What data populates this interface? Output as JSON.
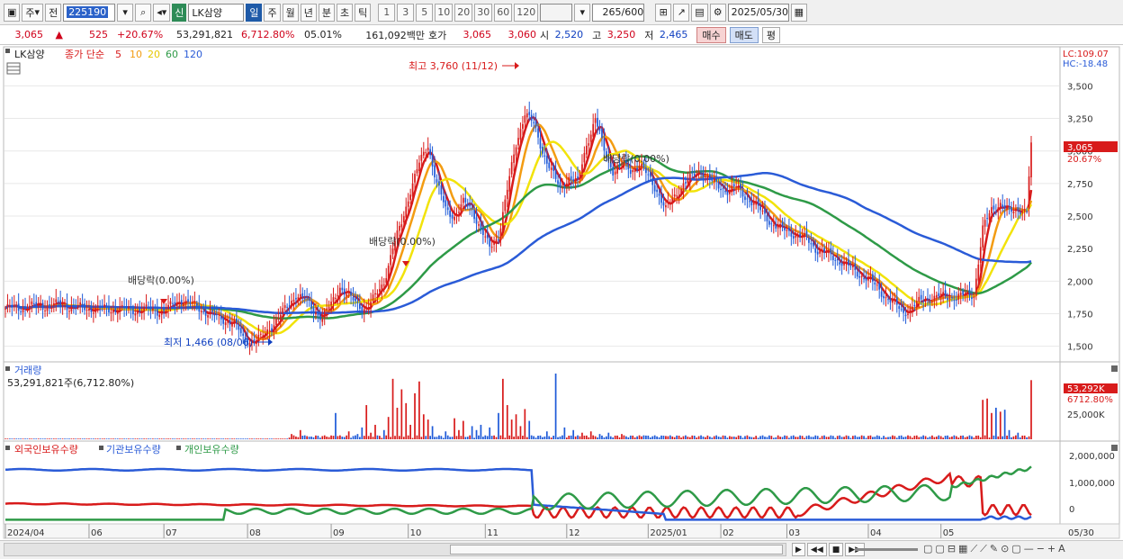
{
  "toolbar": {
    "period_type": "주",
    "prev_label": "전",
    "code": "225190",
    "badge": "신",
    "name": "LK삼양",
    "periods": [
      "일",
      "주",
      "월",
      "년",
      "분",
      "초",
      "틱"
    ],
    "active_period": "일",
    "intervals": [
      "1",
      "3",
      "5",
      "10",
      "20",
      "30",
      "60",
      "120"
    ],
    "count": "265",
    "count_max": "/600",
    "date": "2025/05/30"
  },
  "quote": {
    "price": "3,065",
    "change": "525",
    "change_pct": "+20.67%",
    "volume": "53,291,821",
    "volume_pct": "6,712.80%",
    "turnover_pct": "05.01%",
    "amount": "161,092백만",
    "bid_label": "호가",
    "ask": "3,065",
    "bid": "3,060",
    "open_label": "시",
    "open": "2,520",
    "high_label": "고",
    "high": "3,250",
    "low_label": "저",
    "low": "2,465",
    "buy_label": "매수",
    "sell_label": "매도",
    "pyeong_label": "평"
  },
  "chart_data": {
    "type": "candlestick",
    "legend": {
      "name": "LK삼양",
      "ma_label": "종가 단순",
      "ma_periods": [
        "5",
        "10",
        "20",
        "60",
        "120"
      ],
      "ma_colors": [
        "#d81b1b",
        "#f39c12",
        "#f2e30a",
        "#2e9a47",
        "#2a5bd7"
      ]
    },
    "price_axis": [
      "3,500",
      "3,250",
      "3,000",
      "2,750",
      "2,500",
      "2,250",
      "2,000",
      "1,750",
      "1,500"
    ],
    "price_range": [
      1380,
      3800
    ],
    "lc": "LC:109.07",
    "hc": "HC:-18.48",
    "last_price_tag": "3,065",
    "last_pct_tag": "20.67%",
    "annotations": {
      "high": "최고 3,760 (11/12)",
      "low": "최저 1,466 (08/06)",
      "div1": "배당락(0.00%)",
      "div2": "배당락(0.00%)",
      "div3": "배당락(0.00%)"
    },
    "x_labels": [
      "2024/04",
      "06",
      "07",
      "08",
      "09",
      "10",
      "11",
      "12",
      "2025/01",
      "02",
      "03",
      "04",
      "05"
    ],
    "x_right_label": "05/30",
    "close_points": [
      [
        0,
        1790
      ],
      [
        8,
        1800
      ],
      [
        16,
        1810
      ],
      [
        24,
        1820
      ],
      [
        32,
        1800
      ],
      [
        40,
        1790
      ],
      [
        48,
        1785
      ],
      [
        56,
        1780
      ],
      [
        64,
        1780
      ],
      [
        72,
        1770
      ],
      [
        80,
        1860
      ],
      [
        84,
        1820
      ],
      [
        88,
        1790
      ],
      [
        92,
        1760
      ],
      [
        96,
        1720
      ],
      [
        100,
        1700
      ],
      [
        104,
        1680
      ],
      [
        108,
        1560
      ],
      [
        112,
        1540
      ],
      [
        116,
        1560
      ],
      [
        120,
        1640
      ],
      [
        124,
        1720
      ],
      [
        128,
        1800
      ],
      [
        132,
        1900
      ],
      [
        136,
        1860
      ],
      [
        140,
        1780
      ],
      [
        144,
        1720
      ],
      [
        148,
        1820
      ],
      [
        152,
        1960
      ],
      [
        156,
        1880
      ],
      [
        160,
        1820
      ],
      [
        164,
        1790
      ],
      [
        168,
        1880
      ],
      [
        172,
        2000
      ],
      [
        176,
        2250
      ],
      [
        180,
        2450
      ],
      [
        184,
        2700
      ],
      [
        188,
        2900
      ],
      [
        192,
        3050
      ],
      [
        196,
        2750
      ],
      [
        200,
        2550
      ],
      [
        204,
        2500
      ],
      [
        208,
        2600
      ],
      [
        212,
        2550
      ],
      [
        216,
        2400
      ],
      [
        220,
        2250
      ],
      [
        224,
        2350
      ],
      [
        228,
        2700
      ],
      [
        232,
        3050
      ],
      [
        236,
        3300
      ],
      [
        240,
        3200
      ],
      [
        244,
        3000
      ],
      [
        248,
        2850
      ],
      [
        252,
        2700
      ],
      [
        256,
        2800
      ],
      [
        260,
        2750
      ],
      [
        264,
        3050
      ],
      [
        268,
        3250
      ],
      [
        272,
        3000
      ],
      [
        276,
        2850
      ],
      [
        280,
        2900
      ],
      [
        284,
        2850
      ],
      [
        288,
        2900
      ],
      [
        292,
        2800
      ],
      [
        296,
        2700
      ],
      [
        300,
        2550
      ],
      [
        304,
        2650
      ],
      [
        308,
        2750
      ],
      [
        312,
        2800
      ],
      [
        316,
        2850
      ],
      [
        320,
        2780
      ],
      [
        324,
        2720
      ],
      [
        328,
        2700
      ],
      [
        332,
        2720
      ],
      [
        336,
        2650
      ],
      [
        340,
        2600
      ],
      [
        344,
        2520
      ],
      [
        348,
        2450
      ],
      [
        352,
        2400
      ],
      [
        356,
        2380
      ],
      [
        360,
        2350
      ],
      [
        364,
        2320
      ],
      [
        368,
        2250
      ],
      [
        372,
        2220
      ],
      [
        376,
        2180
      ],
      [
        380,
        2150
      ],
      [
        384,
        2100
      ],
      [
        388,
        2050
      ],
      [
        392,
        2020
      ],
      [
        396,
        1950
      ],
      [
        400,
        1880
      ],
      [
        404,
        1820
      ],
      [
        408,
        1760
      ],
      [
        412,
        1800
      ],
      [
        416,
        1850
      ],
      [
        420,
        1870
      ],
      [
        424,
        1880
      ],
      [
        428,
        1880
      ],
      [
        432,
        1880
      ],
      [
        436,
        1890
      ],
      [
        440,
        1900
      ],
      [
        444,
        2400
      ],
      [
        448,
        2550
      ],
      [
        452,
        2600
      ],
      [
        456,
        2520
      ],
      [
        460,
        2560
      ],
      [
        464,
        2540
      ],
      [
        466,
        3065
      ]
    ],
    "volume_label": "거래량",
    "volume_value": "53,291,821주(6,712.80%)",
    "volume_axis": [
      "25,000K"
    ],
    "volume_tag_1": "53,292K",
    "volume_tag_2": "6712.80%",
    "volume_bars": [
      [
        130,
        8
      ],
      [
        134,
        14
      ],
      [
        136,
        6
      ],
      [
        138,
        4
      ],
      [
        140,
        3
      ],
      [
        150,
        40
      ],
      [
        156,
        12
      ],
      [
        160,
        8
      ],
      [
        162,
        18
      ],
      [
        164,
        52
      ],
      [
        166,
        10
      ],
      [
        168,
        22
      ],
      [
        172,
        14
      ],
      [
        174,
        34
      ],
      [
        176,
        92
      ],
      [
        178,
        48
      ],
      [
        180,
        76
      ],
      [
        182,
        55
      ],
      [
        184,
        22
      ],
      [
        186,
        70
      ],
      [
        188,
        88
      ],
      [
        190,
        38
      ],
      [
        192,
        30
      ],
      [
        194,
        20
      ],
      [
        200,
        12
      ],
      [
        204,
        32
      ],
      [
        206,
        14
      ],
      [
        208,
        28
      ],
      [
        212,
        20
      ],
      [
        214,
        14
      ],
      [
        216,
        22
      ],
      [
        220,
        18
      ],
      [
        224,
        40
      ],
      [
        226,
        92
      ],
      [
        228,
        52
      ],
      [
        230,
        30
      ],
      [
        232,
        38
      ],
      [
        234,
        20
      ],
      [
        236,
        46
      ],
      [
        238,
        28
      ],
      [
        246,
        12
      ],
      [
        250,
        100
      ],
      [
        254,
        18
      ],
      [
        258,
        14
      ],
      [
        262,
        10
      ],
      [
        266,
        12
      ],
      [
        270,
        8
      ],
      [
        274,
        10
      ],
      [
        280,
        8
      ],
      [
        290,
        6
      ],
      [
        300,
        5
      ],
      [
        310,
        4
      ],
      [
        320,
        4
      ],
      [
        330,
        4
      ],
      [
        340,
        3
      ],
      [
        350,
        3
      ],
      [
        400,
        3
      ],
      [
        420,
        4
      ],
      [
        444,
        60
      ],
      [
        446,
        62
      ],
      [
        448,
        40
      ],
      [
        450,
        48
      ],
      [
        452,
        42
      ],
      [
        454,
        45
      ],
      [
        456,
        14
      ],
      [
        460,
        10
      ],
      [
        466,
        90
      ]
    ],
    "holdings_legend": [
      "외국인보유수량",
      "기관보유수량",
      "개인보유수량"
    ],
    "holdings_axis": [
      "2,000,000",
      "1,000,000",
      "0"
    ],
    "holdings_foreign_color": "#d81b1b",
    "holdings_inst_color": "#2a5bd7",
    "holdings_indiv_color": "#2e9a47"
  }
}
